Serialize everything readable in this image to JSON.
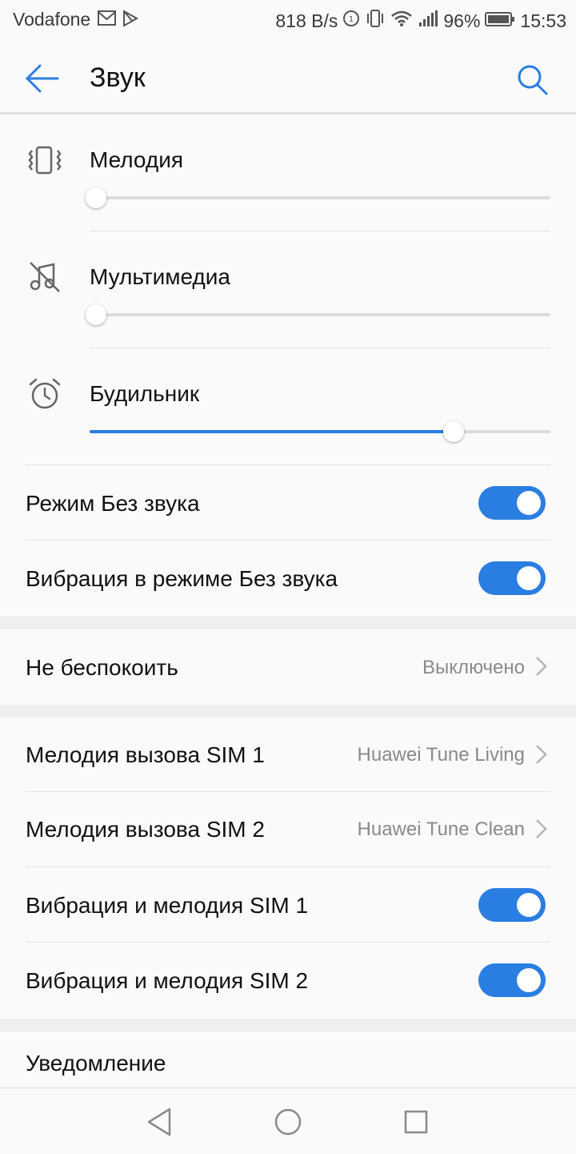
{
  "status_bar": {
    "carrier": "Vodafone",
    "speed": "818 B/s",
    "battery": "96%",
    "time": "15:53"
  },
  "header": {
    "title": "Звук"
  },
  "volumes": [
    {
      "label": "Мелодия",
      "icon": "vibrate-phone-icon",
      "level": 0.0
    },
    {
      "label": "Мультимедиа",
      "icon": "music-muted-icon",
      "level": 0.0
    },
    {
      "label": "Будильник",
      "icon": "alarm-clock-icon",
      "level": 0.79
    }
  ],
  "toggles_top": [
    {
      "label": "Режим Без звука",
      "on": true
    },
    {
      "label": "Вибрация в режиме Без звука",
      "on": true
    }
  ],
  "dnd": {
    "label": "Не беспокоить",
    "value": "Выключено"
  },
  "ringtones": [
    {
      "label": "Мелодия вызова SIM 1",
      "value": "Huawei Tune Living"
    },
    {
      "label": "Мелодия вызова SIM 2",
      "value": "Huawei Tune Clean"
    }
  ],
  "toggles_sim": [
    {
      "label": "Вибрация и мелодия SIM 1",
      "on": true
    },
    {
      "label": "Вибрация и мелодия SIM 2",
      "on": true
    }
  ],
  "notification": {
    "label": "Уведомление"
  },
  "colors": {
    "accent": "#2a7de1"
  }
}
